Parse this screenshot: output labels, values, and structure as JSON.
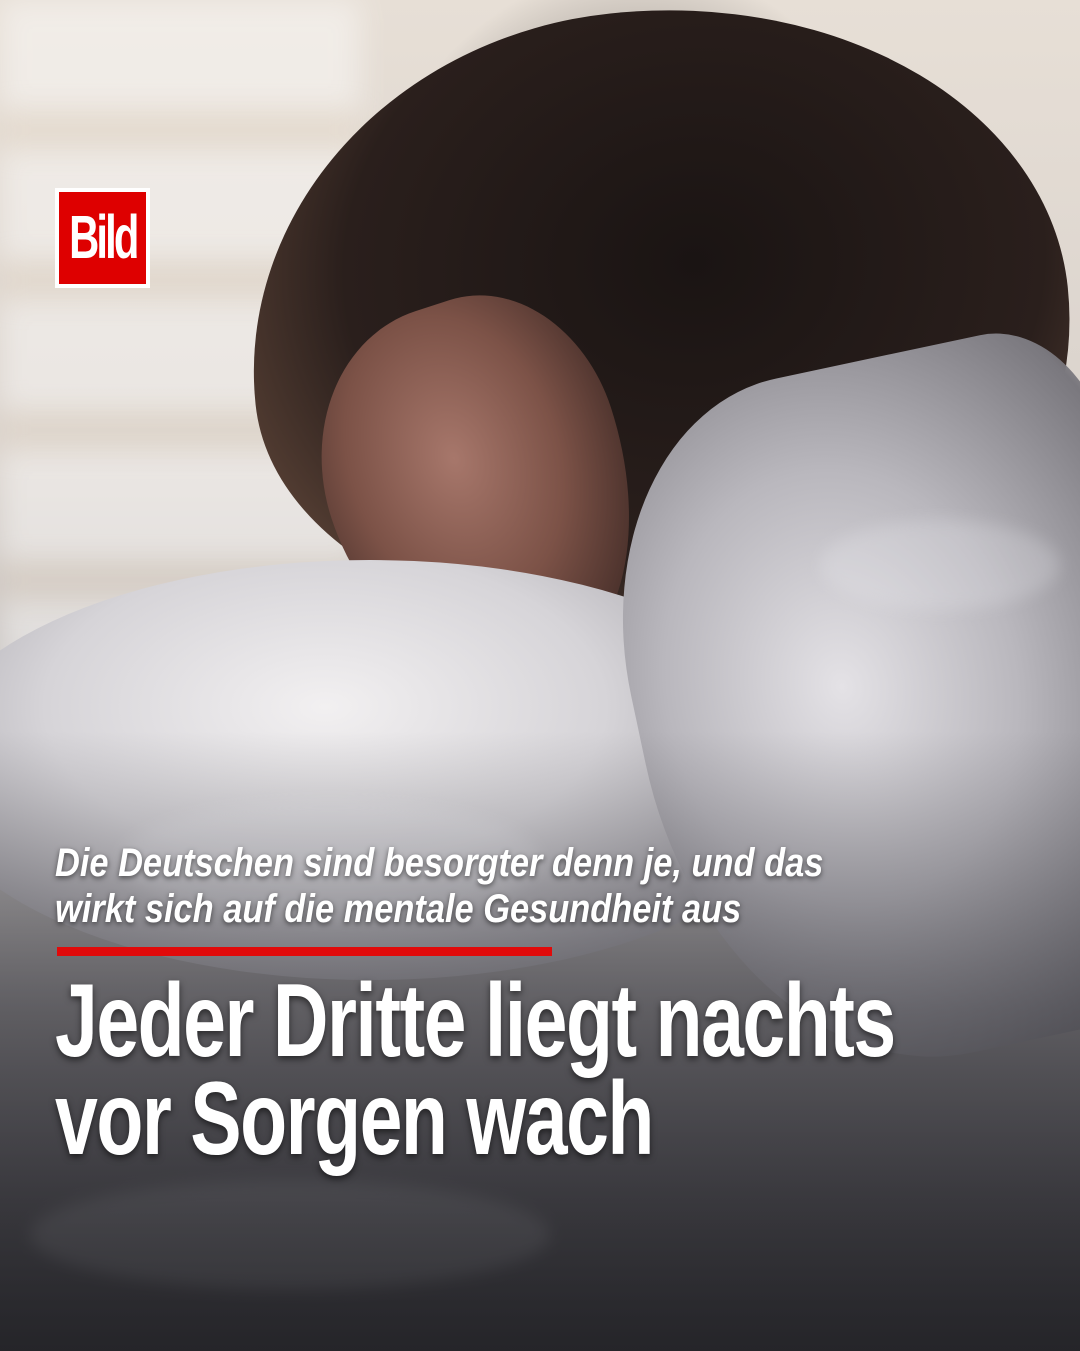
{
  "logo": {
    "text": "Bild",
    "colors": {
      "background": "#de0000",
      "border": "#ffffff",
      "text": "#ffffff"
    }
  },
  "subheadline": {
    "line1": "Die Deutschen sind besorgter denn je, und das",
    "line2": "wirkt sich auf die mentale Gesundheit aus"
  },
  "headline": {
    "line1": "Jeder Dritte liegt nachts",
    "line2": "vor Sorgen wach"
  },
  "accent_color": "#e10a0a",
  "text_color": "#ffffff"
}
